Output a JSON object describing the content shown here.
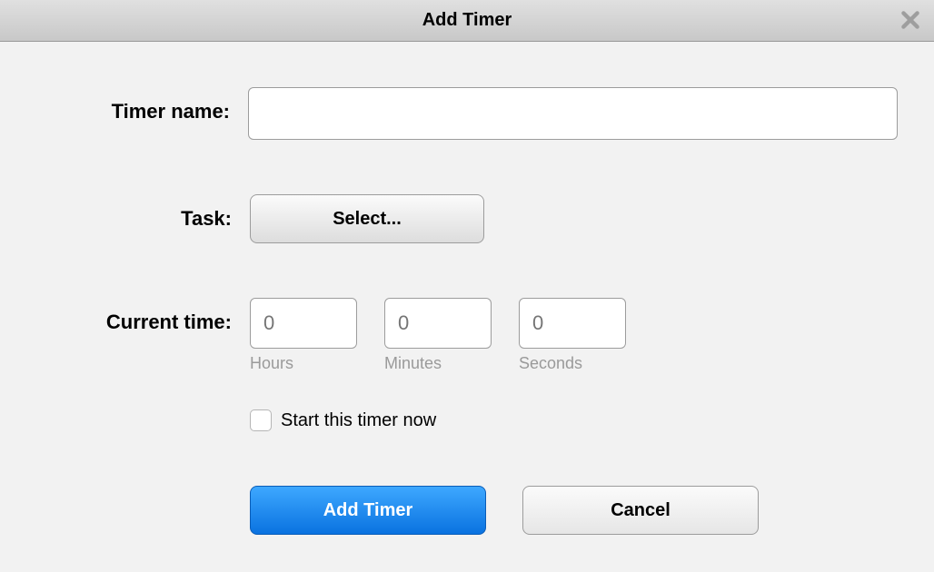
{
  "dialog": {
    "title": "Add Timer"
  },
  "form": {
    "timer_name": {
      "label": "Timer name:",
      "value": ""
    },
    "task": {
      "label": "Task:",
      "select_button": "Select..."
    },
    "current_time": {
      "label": "Current time:",
      "hours": {
        "placeholder": "0",
        "sublabel": "Hours"
      },
      "minutes": {
        "placeholder": "0",
        "sublabel": "Minutes"
      },
      "seconds": {
        "placeholder": "0",
        "sublabel": "Seconds"
      }
    },
    "start_now": {
      "label": "Start this timer now",
      "checked": false
    }
  },
  "actions": {
    "primary": "Add Timer",
    "cancel": "Cancel"
  }
}
